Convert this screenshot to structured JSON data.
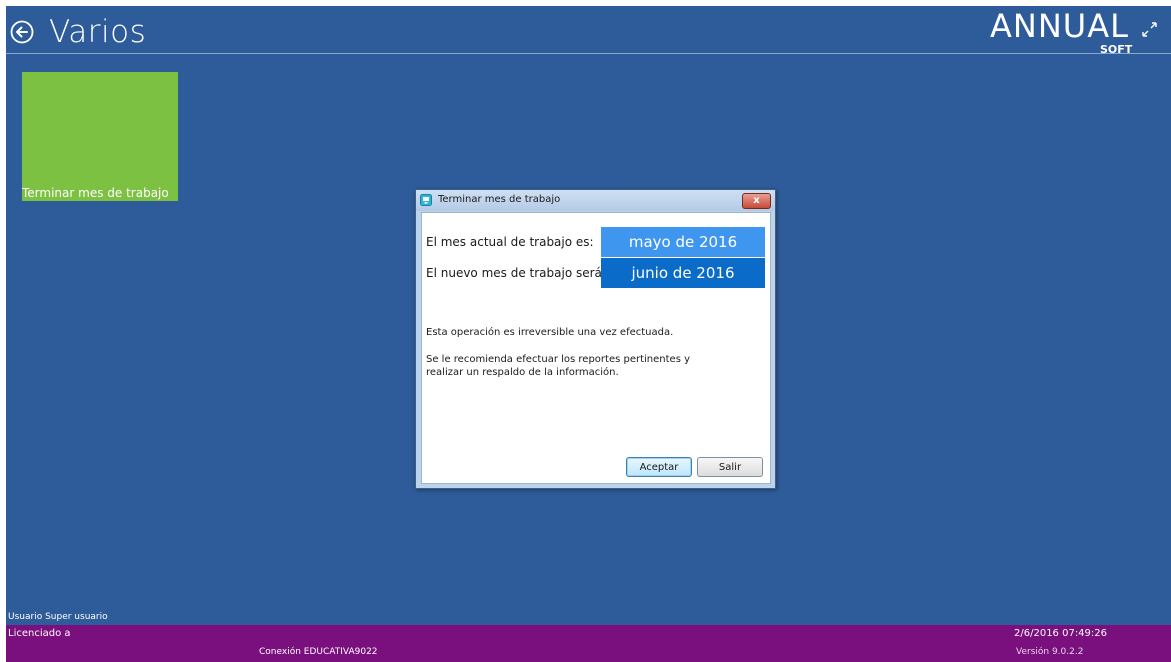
{
  "app": {
    "page_title": "Varios",
    "logo_text": "ANNUAL",
    "logo_sub": "SOFT"
  },
  "tiles": [
    {
      "label": "Terminar mes de trabajo",
      "color": "#7dc142"
    }
  ],
  "dialog": {
    "title": "Terminar mes de trabajo",
    "close_label": "x",
    "current_month_label": "El mes actual de trabajo es:",
    "current_month_value": "mayo de 2016",
    "new_month_label": "El nuevo mes de trabajo será:",
    "new_month_value": "junio de 2016",
    "message_1": "Esta operación es irreversible una vez efectuada.",
    "message_2_line1": "Se le recomienda efectuar los reportes pertinentes y",
    "message_2_line2": "realizar un respaldo de la información.",
    "accept_label": "Aceptar",
    "exit_label": "Salir"
  },
  "status": {
    "user_label": "Usuario",
    "user_value": "Super usuario",
    "licensed_label": "Licenciado a",
    "connection_label": "Conexión",
    "connection_value": "EDUCATIVA9022",
    "datetime": "2/6/2016 07:49:26",
    "version": "Versión 9.0.2.2"
  },
  "colors": {
    "background": "#2e5c9a",
    "footer": "#7a0f7e",
    "current_month": "#3f96ef",
    "new_month": "#0a6bc9"
  }
}
